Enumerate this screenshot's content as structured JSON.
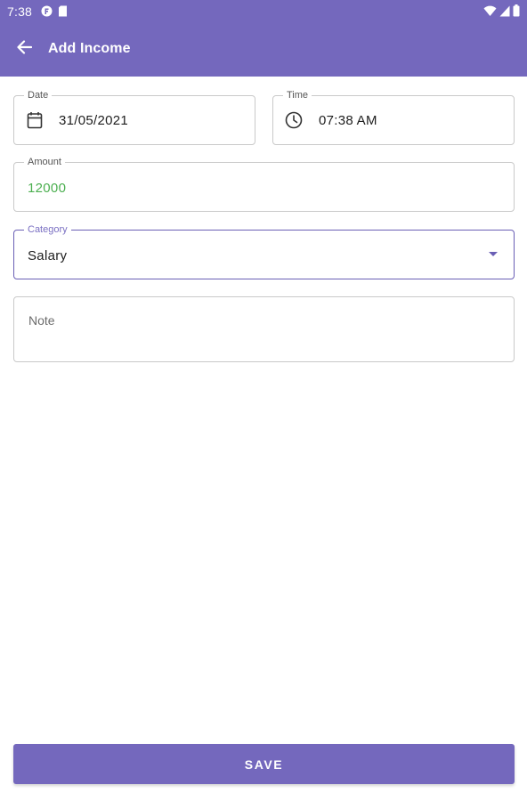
{
  "status_bar": {
    "time": "7:38",
    "left_icons": [
      "app-notification-icon",
      "sd-card-icon"
    ],
    "right_icons": [
      "wifi-icon",
      "signal-icon",
      "battery-icon"
    ]
  },
  "toolbar": {
    "title": "Add Income",
    "back_icon": "arrow-back-icon"
  },
  "form": {
    "date": {
      "label": "Date",
      "value": "31/05/2021",
      "icon": "calendar-icon"
    },
    "time": {
      "label": "Time",
      "value": "07:38 AM",
      "icon": "clock-icon"
    },
    "amount": {
      "label": "Amount",
      "value": "12000",
      "value_color": "#4caf50"
    },
    "category": {
      "label": "Category",
      "value": "Salary",
      "icon": "dropdown-arrow-icon"
    },
    "note": {
      "placeholder": "Note"
    }
  },
  "actions": {
    "save_label": "SAVE"
  },
  "colors": {
    "primary": "#7468bd",
    "focus_outline": "#6a5fb5",
    "amount_text": "#4caf50"
  }
}
